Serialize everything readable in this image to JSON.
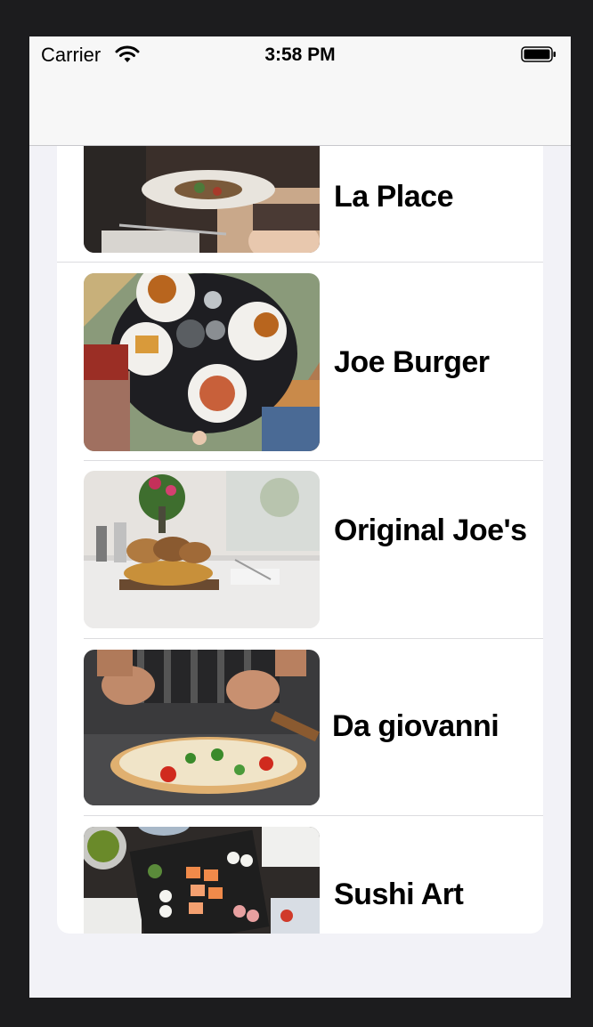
{
  "status_bar": {
    "carrier": "Carrier",
    "time": "3:58 PM",
    "wifi_icon": "wifi-icon",
    "battery_icon": "battery-icon"
  },
  "restaurants": [
    {
      "name": "La Place",
      "image": "restaurant-photo-la-place"
    },
    {
      "name": "Joe Burger",
      "image": "restaurant-photo-joe-burger"
    },
    {
      "name": "Original Joe's",
      "image": "restaurant-photo-original-joes"
    },
    {
      "name": "Da giovanni",
      "image": "restaurant-photo-da-giovanni"
    },
    {
      "name": "Sushi Art",
      "image": "restaurant-photo-sushi-art"
    }
  ]
}
